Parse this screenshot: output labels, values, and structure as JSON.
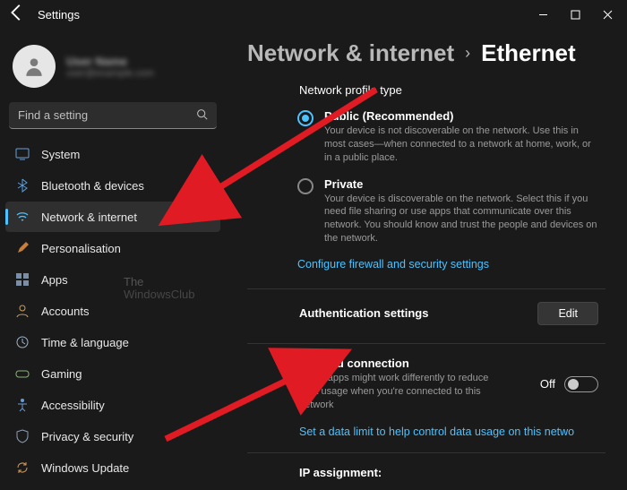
{
  "window": {
    "title": "Settings"
  },
  "profile": {
    "name": "User Name",
    "email": "user@example.com"
  },
  "search": {
    "placeholder": "Find a setting"
  },
  "sidebar": {
    "items": [
      {
        "label": "System"
      },
      {
        "label": "Bluetooth & devices"
      },
      {
        "label": "Network & internet"
      },
      {
        "label": "Personalisation"
      },
      {
        "label": "Apps"
      },
      {
        "label": "Accounts"
      },
      {
        "label": "Time & language"
      },
      {
        "label": "Gaming"
      },
      {
        "label": "Accessibility"
      },
      {
        "label": "Privacy & security"
      },
      {
        "label": "Windows Update"
      }
    ]
  },
  "breadcrumb": {
    "parent": "Network & internet",
    "current": "Ethernet"
  },
  "profile_section": {
    "title": "Network profile type",
    "public_label": "Public (Recommended)",
    "public_desc": "Your device is not discoverable on the network. Use this in most cases—when connected to a network at home, work, or in a public place.",
    "private_label": "Private",
    "private_desc": "Your device is discoverable on the network. Select this if you need file sharing or use apps that communicate over this network. You should know and trust the people and devices on the network.",
    "firewall_link": "Configure firewall and security settings"
  },
  "auth": {
    "title": "Authentication settings",
    "button": "Edit"
  },
  "metered": {
    "title": "Metered connection",
    "desc": "Some apps might work differently to reduce data usage when you're connected to this network",
    "state": "Off",
    "link": "Set a data limit to help control data usage on this netwo"
  },
  "ip": {
    "title": "IP assignment:"
  },
  "watermark": {
    "line1": "The",
    "line2": "WindowsClub"
  },
  "colors": {
    "accent": "#4cc2ff"
  }
}
